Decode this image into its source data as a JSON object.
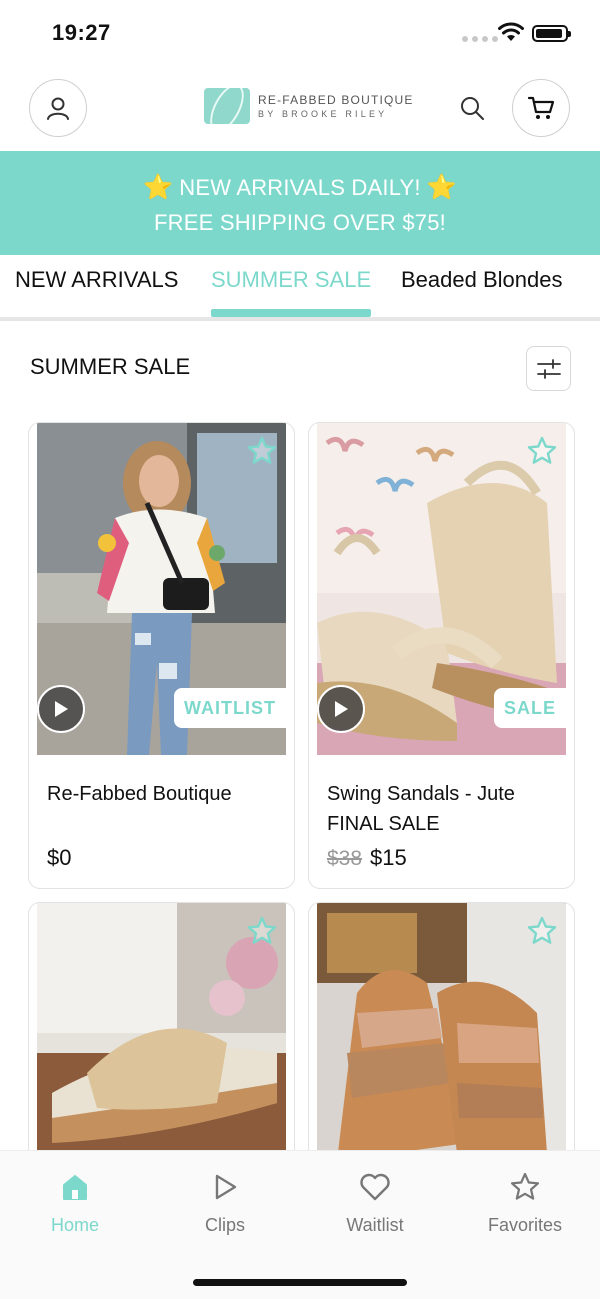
{
  "status_bar": {
    "time": "19:27"
  },
  "header": {
    "brand_line1": "RE-FABBED BOUTIQUE",
    "brand_line2": "BY BROOKE RILEY",
    "icons": {
      "account": "user-icon",
      "search": "search-icon",
      "cart": "cart-icon"
    }
  },
  "promo": {
    "line1": "NEW ARRIVALS DAILY!",
    "line2": "FREE SHIPPING OVER $75!",
    "emoji": "⭐"
  },
  "tabs": [
    {
      "label": "NEW ARRIVALS",
      "active": false
    },
    {
      "label": "SUMMER SALE",
      "active": true
    },
    {
      "label": "Beaded Blondes",
      "active": false
    }
  ],
  "section": {
    "title": "SUMMER SALE"
  },
  "products": [
    {
      "name": "Re-Fabbed Boutique",
      "badge": "WAITLIST",
      "price": "$0",
      "has_video": true
    },
    {
      "name": "Swing Sandals - Jute",
      "subtitle": "FINAL SALE",
      "badge": "SALE",
      "price_old": "$38",
      "price": "$15",
      "has_video": true
    },
    {
      "name": "",
      "has_video": false
    },
    {
      "name": "",
      "has_video": false
    }
  ],
  "bottom_nav": [
    {
      "label": "Home",
      "icon": "home-icon",
      "active": true
    },
    {
      "label": "Clips",
      "icon": "play-icon",
      "active": false
    },
    {
      "label": "Waitlist",
      "icon": "heart-icon",
      "active": false
    },
    {
      "label": "Favorites",
      "icon": "star-icon",
      "active": false
    }
  ],
  "colors": {
    "accent": "#7dd8cc",
    "text": "#111111",
    "muted": "#777777"
  }
}
